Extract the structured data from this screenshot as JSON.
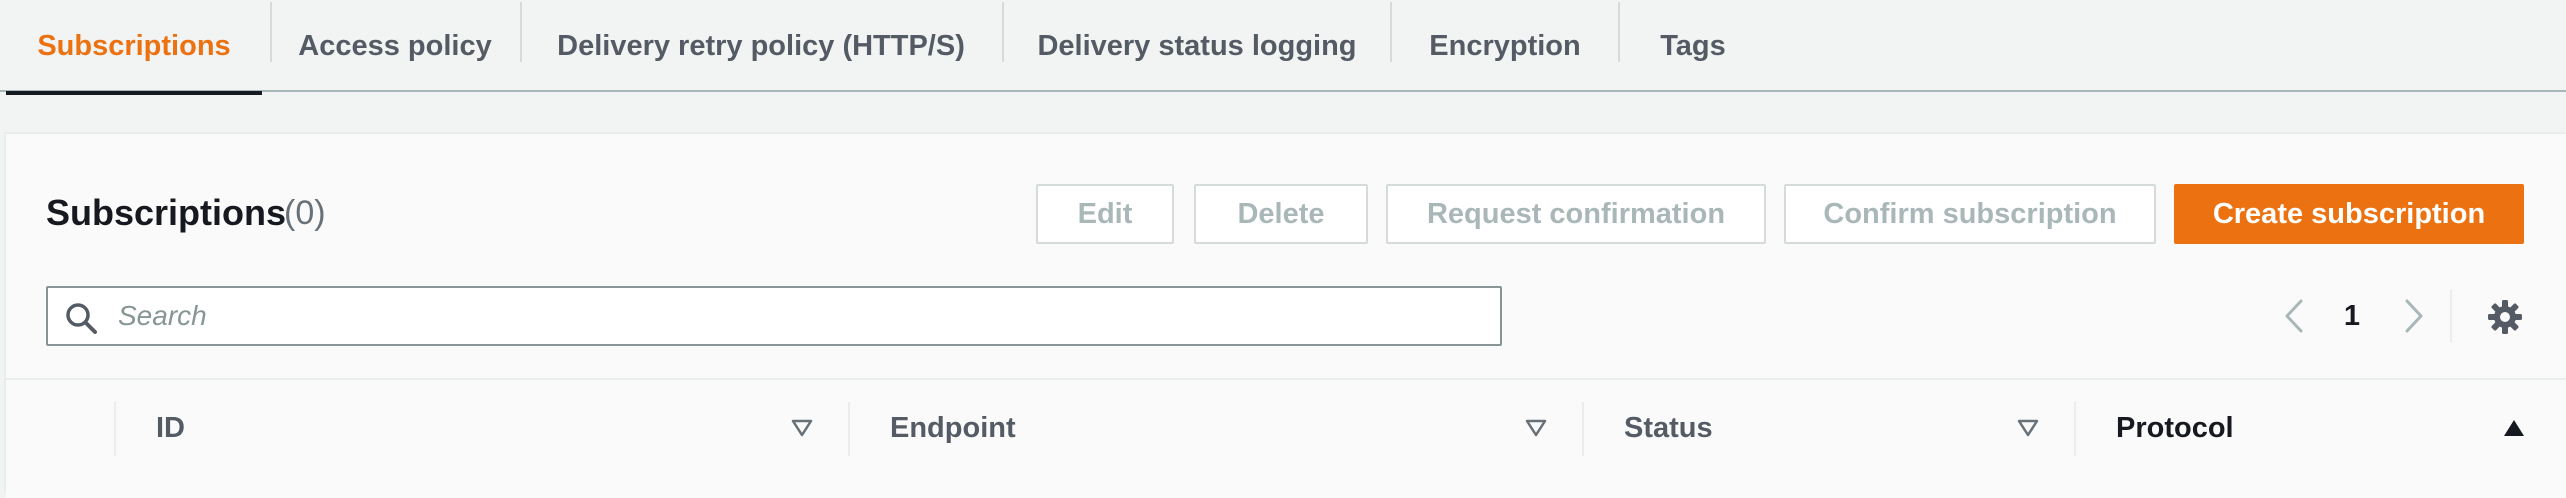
{
  "tabs": [
    {
      "label": "Subscriptions",
      "active": true
    },
    {
      "label": "Access policy",
      "active": false
    },
    {
      "label": "Delivery retry policy (HTTP/S)",
      "active": false
    },
    {
      "label": "Delivery status logging",
      "active": false
    },
    {
      "label": "Encryption",
      "active": false
    },
    {
      "label": "Tags",
      "active": false
    }
  ],
  "panel": {
    "title": "Subscriptions",
    "count": "(0)"
  },
  "actions": {
    "edit": "Edit",
    "delete": "Delete",
    "request_confirmation": "Request confirmation",
    "confirm_subscription": "Confirm subscription",
    "create_subscription": "Create subscription"
  },
  "search": {
    "placeholder": "Search",
    "value": ""
  },
  "pagination": {
    "current_page": "1"
  },
  "table": {
    "columns": [
      {
        "label": "ID",
        "sort": "none"
      },
      {
        "label": "Endpoint",
        "sort": "none"
      },
      {
        "label": "Status",
        "sort": "none"
      },
      {
        "label": "Protocol",
        "sort": "ascending"
      }
    ]
  },
  "colors": {
    "accent": "#ec7211",
    "text": "#16191f",
    "muted": "#545b64",
    "disabled": "#aab7b8",
    "background": "#f2f3f3"
  },
  "icons": {
    "search": "search-icon",
    "prev": "chevron-left-icon",
    "next": "chevron-right-icon",
    "settings": "gear-icon",
    "sort_none": "sort-triangle-down-outline-icon",
    "sort_ascending": "sort-triangle-up-filled-icon"
  }
}
